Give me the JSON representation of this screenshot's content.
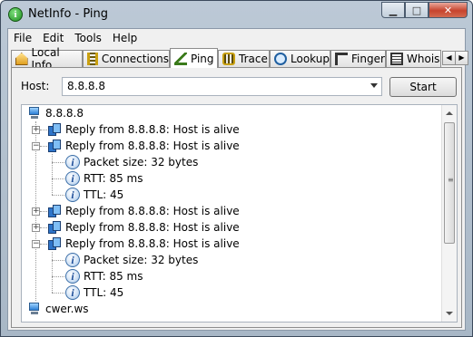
{
  "window": {
    "title": "NetInfo - Ping"
  },
  "menu": [
    "File",
    "Edit",
    "Tools",
    "Help"
  ],
  "tabs": [
    {
      "label": "Local Info",
      "icon": "house-icon"
    },
    {
      "label": "Connections",
      "icon": "connections-icon"
    },
    {
      "label": "Ping",
      "icon": "ping-icon",
      "active": true
    },
    {
      "label": "Trace",
      "icon": "trace-icon"
    },
    {
      "label": "Lookup",
      "icon": "lookup-icon"
    },
    {
      "label": "Finger",
      "icon": "finger-icon"
    },
    {
      "label": "Whois",
      "icon": "whois-icon"
    }
  ],
  "host": {
    "label": "Host:",
    "value": "8.8.8.8"
  },
  "start_button": "Start",
  "tree": {
    "root1": "8.8.8.8",
    "reply": "Reply from 8.8.8.8: Host is alive",
    "packet_size": "Packet size: 32 bytes",
    "rtt": "RTT: 85 ms",
    "ttl": "TTL: 45",
    "root2": "cwer.ws"
  },
  "colors": {
    "accent": "#2d74c9",
    "close": "#c7432d"
  }
}
